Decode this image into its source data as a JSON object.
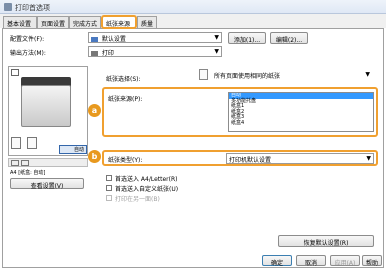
{
  "window": {
    "title": "打印首选项"
  },
  "tabs": [
    {
      "label": "基本设置"
    },
    {
      "label": "页面设置"
    },
    {
      "label": "完成方式"
    },
    {
      "label": "纸张来源"
    },
    {
      "label": "质量"
    }
  ],
  "profile": {
    "label": "配置文件(F):",
    "value": "默认设置",
    "add_label": "添加(1)...",
    "edit_label": "编辑(2)..."
  },
  "output": {
    "label": "输出方法(M):",
    "value": "打印"
  },
  "paper_selection": {
    "label": "纸张选择(S):",
    "value": "所有页面使用相同的纸张"
  },
  "paper_source": {
    "label": "纸张来源(P):",
    "items": [
      "自动",
      "多功能托盘",
      "纸盒1",
      "纸盒2",
      "纸盒3",
      "纸盒4"
    ],
    "selected_index": 0
  },
  "paper_type": {
    "label": "纸张类型(Y):",
    "value": "打印机默认设置"
  },
  "preview": {
    "selected_label": "自动",
    "status_text": "A4 [纸盒: 自动]",
    "view_settings_label": "查看设置(V)"
  },
  "options": {
    "letter": {
      "label": "首选送入 A4/Letter(R)"
    },
    "custom": {
      "label": "首选送入自定义纸张(U)"
    },
    "other": {
      "label": "打印在另一面(B)"
    }
  },
  "restore_defaults_label": "恢复默认设置(R)",
  "dialog_buttons": {
    "ok": "确定",
    "cancel": "取消",
    "apply": "应用(A)",
    "help": "帮助"
  },
  "callouts": {
    "a": "a",
    "b": "b"
  },
  "colors": {
    "accent_orange": "#e8991e",
    "selection_blue": "#3399ff"
  }
}
